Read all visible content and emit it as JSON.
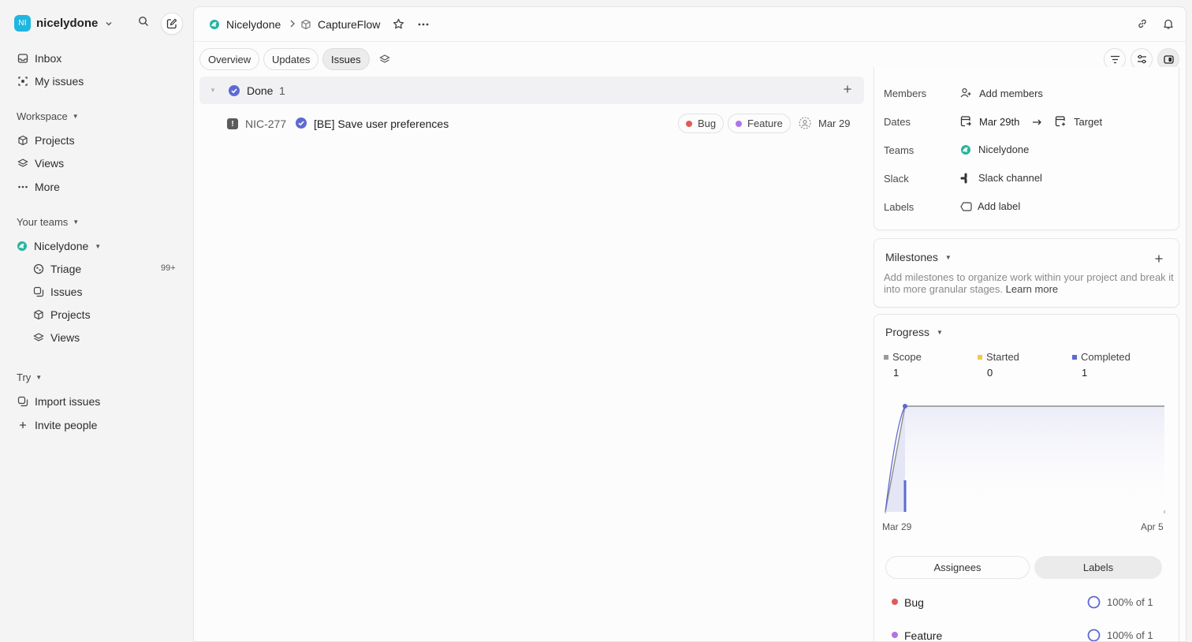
{
  "workspace": {
    "initials": "NI",
    "name": "nicelydone"
  },
  "sidebar": {
    "top_items": [
      {
        "label": "Inbox"
      },
      {
        "label": "My issues"
      }
    ],
    "workspace_section": "Workspace",
    "workspace_items": [
      {
        "label": "Projects"
      },
      {
        "label": "Views"
      },
      {
        "label": "More"
      }
    ],
    "teams_section": "Your teams",
    "team_name": "Nicelydone",
    "team_items": [
      {
        "label": "Triage",
        "count": "99+"
      },
      {
        "label": "Issues"
      },
      {
        "label": "Projects"
      },
      {
        "label": "Views"
      }
    ],
    "try_section": "Try",
    "try_items": [
      {
        "label": "Import issues"
      },
      {
        "label": "Invite people"
      }
    ]
  },
  "header": {
    "team": "Nicelydone",
    "project": "CaptureFlow"
  },
  "tabs": [
    {
      "label": "Overview"
    },
    {
      "label": "Updates"
    },
    {
      "label": "Issues",
      "active": true
    }
  ],
  "group": {
    "title": "Done",
    "count": "1"
  },
  "issue": {
    "priority": "!",
    "id": "NIC-277",
    "title": "[BE] Save user preferences",
    "labels": [
      {
        "name": "Bug",
        "color": "#e05a5a"
      },
      {
        "name": "Feature",
        "color": "#b173e6"
      }
    ],
    "due": "Mar 29"
  },
  "properties": {
    "members_label": "Members",
    "members_value": "Add members",
    "dates_label": "Dates",
    "start_date": "Mar 29th",
    "target": "Target",
    "teams_label": "Teams",
    "team_value": "Nicelydone",
    "slack_label": "Slack",
    "slack_value": "Slack channel",
    "labels_label": "Labels",
    "labels_value": "Add label"
  },
  "milestones": {
    "title": "Milestones",
    "description": "Add milestones to organize work within your project and break it into more granular stages.",
    "learn_more": "Learn more"
  },
  "progress": {
    "title": "Progress",
    "scope_label": "Scope",
    "scope_value": "1",
    "started_label": "Started",
    "started_value": "0",
    "completed_label": "Completed",
    "completed_value": "1",
    "x_start": "Mar 29",
    "x_end": "Apr 5",
    "segments": [
      {
        "label": "Assignees"
      },
      {
        "label": "Labels",
        "active": true
      }
    ],
    "label_rows": [
      {
        "name": "Bug",
        "color": "#e05a5a",
        "percent": "100% of 1"
      },
      {
        "name": "Feature",
        "color": "#b173e6",
        "percent": "100% of 1"
      }
    ]
  },
  "colors": {
    "accent": "#5e6ad2",
    "started": "#f2c94c",
    "scope": "#9b9b9b",
    "team_icon": "#26b5a0"
  },
  "chart_data": {
    "type": "line",
    "x": [
      "Mar 29",
      "Apr 5"
    ],
    "series": [
      {
        "name": "Scope",
        "values": [
          1,
          1
        ]
      },
      {
        "name": "Completed",
        "values": [
          1,
          1
        ]
      }
    ]
  }
}
